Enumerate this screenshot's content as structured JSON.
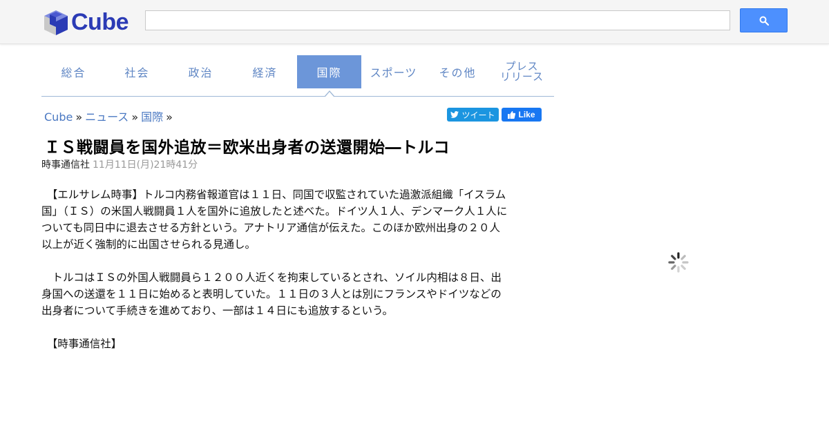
{
  "header": {
    "logo_text": "Cube",
    "search": {
      "value": "",
      "placeholder": ""
    },
    "search_button_icon": "search-icon"
  },
  "tabs": [
    {
      "label": "総合",
      "active": false
    },
    {
      "label": "社会",
      "active": false
    },
    {
      "label": "政治",
      "active": false
    },
    {
      "label": "経済",
      "active": false
    },
    {
      "label": "国際",
      "active": true
    },
    {
      "label": "スポーツ",
      "active": false
    },
    {
      "label": "その他",
      "active": false
    },
    {
      "label_line1": "プレス",
      "label_line2": "リリース",
      "active": false
    }
  ],
  "breadcrumb": {
    "items": [
      "Cube",
      "ニュース",
      "国際"
    ],
    "separator": "»"
  },
  "share": {
    "tweet_label": "ツイート",
    "like_label": "Like"
  },
  "article": {
    "title": "ＩＳ戦闘員を国外追放＝欧米出身者の送還開始―トルコ",
    "source": "時事通信社",
    "date": "11月11日(月)21時41分",
    "paragraphs": [
      "　【エルサレム時事】トルコ内務省報道官は１１日、同国で収監されていた過激派組織「イスラム国」（ＩＳ）の米国人戦闘員１人を国外に追放したと述べた。ドイツ人１人、デンマーク人１人についても同日中に退去させる方針という。アナトリア通信が伝えた。このほか欧州出身の２０人以上が近く強制的に出国させられる見通し。",
      "　トルコはＩＳの外国人戦闘員ら１２００人近くを拘束しているとされ、ソイル内相は８日、出身国への送還を１１日に始めると表明していた。１１日の３人とは別にフランスやドイツなどの出身者について手続きを進めており、一部は１４日にも追放するという。",
      "　【時事通信社】"
    ]
  },
  "colors": {
    "accent": "#6c96d9",
    "link": "#4a78c2",
    "logo": "#2b3bb5",
    "search_button": "#4d90fe"
  }
}
